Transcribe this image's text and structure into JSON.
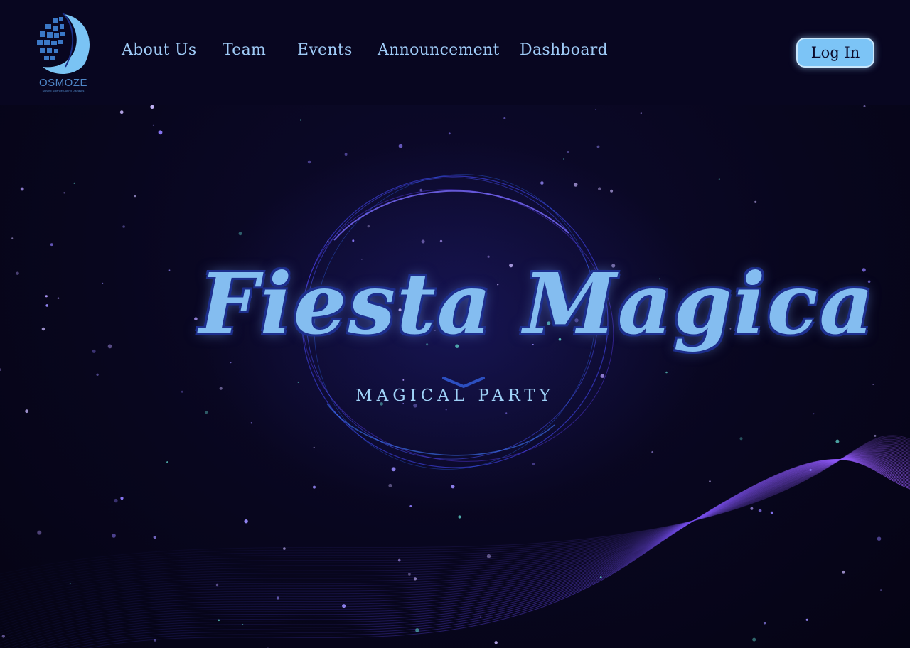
{
  "logo": {
    "name": "OSMOZE",
    "tagline": "Moving Science Curing Diseases",
    "icon": "osmoze-logo"
  },
  "nav": {
    "items": [
      {
        "label": "About Us"
      },
      {
        "label": "Team"
      },
      {
        "label": "Events"
      },
      {
        "label": "Announcement"
      },
      {
        "label": "Dashboard"
      }
    ],
    "login_label": "Log In"
  },
  "hero": {
    "title": "Fiesta Magica",
    "subtitle": "MAGICAL PARTY"
  },
  "colors": {
    "background": "#07051a",
    "header": "#080620",
    "nav_text": "#9fcbf7",
    "button": "#7cc4f6",
    "accent_purple": "#8a4dff"
  }
}
